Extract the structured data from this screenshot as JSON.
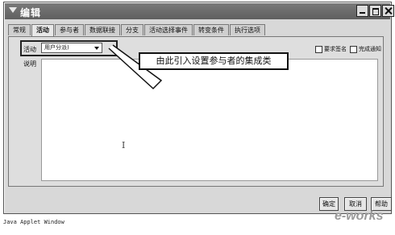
{
  "window": {
    "title": "编辑"
  },
  "tabs": [
    {
      "label": "常规"
    },
    {
      "label": "活动",
      "active": true
    },
    {
      "label": "参与者"
    },
    {
      "label": "数据联接"
    },
    {
      "label": "分支"
    },
    {
      "label": "活动选择事件"
    },
    {
      "label": "转变条件"
    },
    {
      "label": "执行选项"
    }
  ],
  "form": {
    "activity_label": "活动",
    "activity_value": "用户分派)",
    "require_sign_label": "要求签名",
    "notify_label": "完成通知",
    "description_label": "说明"
  },
  "callout": {
    "text": "由此引入设置参与者的集成类"
  },
  "buttons": {
    "ok": "确定",
    "cancel": "取消",
    "help": "帮助"
  },
  "status_bar": {
    "text": "Java Applet Window"
  },
  "watermark": {
    "text": "e-works"
  }
}
